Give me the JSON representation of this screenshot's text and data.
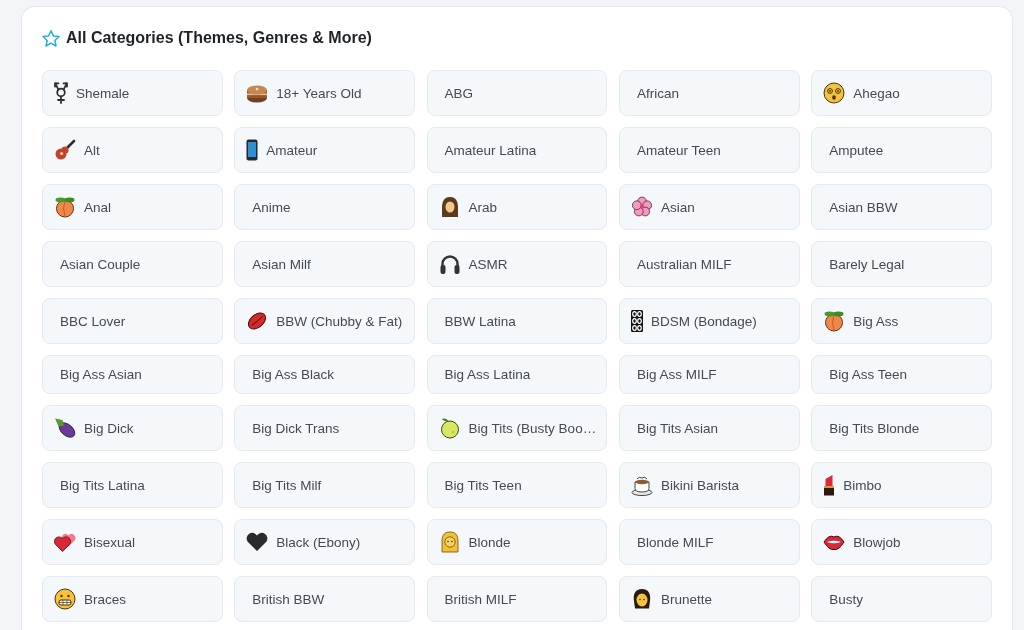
{
  "section": {
    "title": "All Categories (Themes, Genres & More)"
  },
  "categories": [
    {
      "label": "Shemale",
      "kind": "gender"
    },
    {
      "label": "18+ Years Old",
      "kind": "cake"
    },
    {
      "label": "ABG",
      "kind": "plain"
    },
    {
      "label": "African",
      "kind": "plain"
    },
    {
      "label": "Ahegao",
      "kind": "dizzy"
    },
    {
      "label": "Alt",
      "kind": "guitar"
    },
    {
      "label": "Amateur",
      "kind": "phone"
    },
    {
      "label": "Amateur Latina",
      "kind": "plain"
    },
    {
      "label": "Amateur Teen",
      "kind": "plain"
    },
    {
      "label": "Amputee",
      "kind": "plain"
    },
    {
      "label": "Anal",
      "kind": "peach"
    },
    {
      "label": "Anime",
      "kind": "plain"
    },
    {
      "label": "Arab",
      "kind": "headscarf"
    },
    {
      "label": "Asian",
      "kind": "blossom"
    },
    {
      "label": "Asian BBW",
      "kind": "plain"
    },
    {
      "label": "Asian Couple",
      "kind": "plain"
    },
    {
      "label": "Asian Milf",
      "kind": "plain"
    },
    {
      "label": "ASMR",
      "kind": "headphones"
    },
    {
      "label": "Australian MILF",
      "kind": "plain"
    },
    {
      "label": "Barely Legal",
      "kind": "plain"
    },
    {
      "label": "BBC Lover",
      "kind": "plain"
    },
    {
      "label": "BBW (Chubby & Fat)",
      "kind": "lips"
    },
    {
      "label": "BBW Latina",
      "kind": "plain"
    },
    {
      "label": "BDSM (Bondage)",
      "kind": "chain"
    },
    {
      "label": "Big Ass",
      "kind": "peach"
    },
    {
      "label": "Big Ass Asian",
      "kind": "plain"
    },
    {
      "label": "Big Ass Black",
      "kind": "plain"
    },
    {
      "label": "Big Ass Latina",
      "kind": "plain"
    },
    {
      "label": "Big Ass MILF",
      "kind": "plain"
    },
    {
      "label": "Big Ass Teen",
      "kind": "plain"
    },
    {
      "label": "Big Dick",
      "kind": "eggplant"
    },
    {
      "label": "Big Dick Trans",
      "kind": "plain"
    },
    {
      "label": "Big Tits (Busty Boo…",
      "kind": "lemon"
    },
    {
      "label": "Big Tits Asian",
      "kind": "plain"
    },
    {
      "label": "Big Tits Blonde",
      "kind": "plain"
    },
    {
      "label": "Big Tits Latina",
      "kind": "plain"
    },
    {
      "label": "Big Tits Milf",
      "kind": "plain"
    },
    {
      "label": "Big Tits Teen",
      "kind": "plain"
    },
    {
      "label": "Bikini Barista",
      "kind": "coffee"
    },
    {
      "label": "Bimbo",
      "kind": "lipstick"
    },
    {
      "label": "Bisexual",
      "kind": "hearts"
    },
    {
      "label": "Black (Ebony)",
      "kind": "darkheart"
    },
    {
      "label": "Blonde",
      "kind": "longhair"
    },
    {
      "label": "Blonde MILF",
      "kind": "plain"
    },
    {
      "label": "Blowjob",
      "kind": "mouth"
    },
    {
      "label": "Braces",
      "kind": "grimace"
    },
    {
      "label": "British BBW",
      "kind": "plain"
    },
    {
      "label": "British MILF",
      "kind": "plain"
    },
    {
      "label": "Brunette",
      "kind": "person"
    },
    {
      "label": "Busty",
      "kind": "plain"
    }
  ]
}
